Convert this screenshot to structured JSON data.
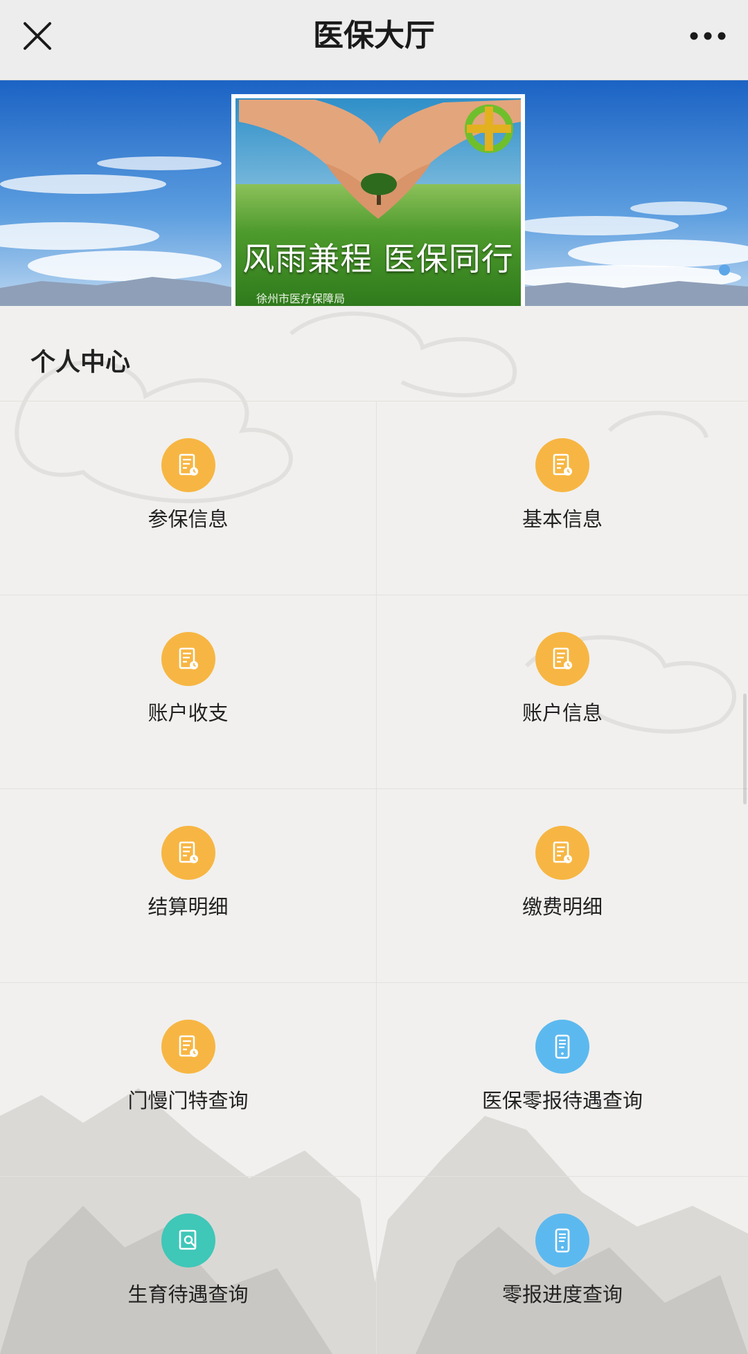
{
  "header": {
    "title": "医保大厅",
    "close_icon": "close-icon",
    "more_icon": "more-dots-icon"
  },
  "banner": {
    "slogan": "风雨兼程 医保同行",
    "org": "徐州市医疗保障局"
  },
  "section": {
    "title": "个人中心"
  },
  "colors": {
    "orange": "#f7b643",
    "blue": "#5cb9ef",
    "teal": "#3fc7b8"
  },
  "menu": [
    {
      "label": "参保信息",
      "icon": "document-icon",
      "color": "orange"
    },
    {
      "label": "基本信息",
      "icon": "document-icon",
      "color": "orange"
    },
    {
      "label": "账户收支",
      "icon": "document-icon",
      "color": "orange"
    },
    {
      "label": "账户信息",
      "icon": "document-icon",
      "color": "orange"
    },
    {
      "label": "结算明细",
      "icon": "document-icon",
      "color": "orange"
    },
    {
      "label": "缴费明细",
      "icon": "document-icon",
      "color": "orange"
    },
    {
      "label": "门慢门特查询",
      "icon": "document-icon",
      "color": "orange"
    },
    {
      "label": "医保零报待遇查询",
      "icon": "phone-icon",
      "color": "blue"
    },
    {
      "label": "生育待遇查询",
      "icon": "search-document-icon",
      "color": "teal"
    },
    {
      "label": "零报进度查询",
      "icon": "phone-icon",
      "color": "blue"
    }
  ]
}
